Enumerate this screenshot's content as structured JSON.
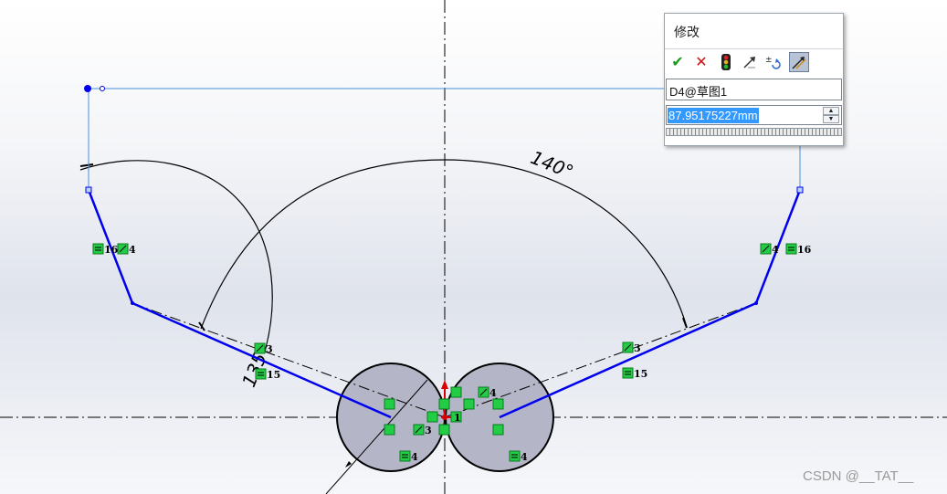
{
  "sketch": {
    "dimensions": {
      "angle_right": "140°",
      "angle_left": "135°"
    },
    "relations": {
      "rel_16": "16",
      "rel_4": "4",
      "rel_3": "3",
      "rel_15": "15",
      "rel_1": "1"
    }
  },
  "dialog": {
    "title": "修改",
    "dimension_name": "D4@草图1",
    "value": "87.95175227mm",
    "buttons": {
      "ok": "✔",
      "cancel": "✕",
      "spin_up": "▲",
      "spin_down": "▼"
    }
  },
  "colors": {
    "sketch_line": "#0000ee",
    "relation_icon": "#22cc44",
    "selection": "#3399ff",
    "circle_fill": "#b4b6c8"
  },
  "watermark": "CSDN @__TAT__"
}
